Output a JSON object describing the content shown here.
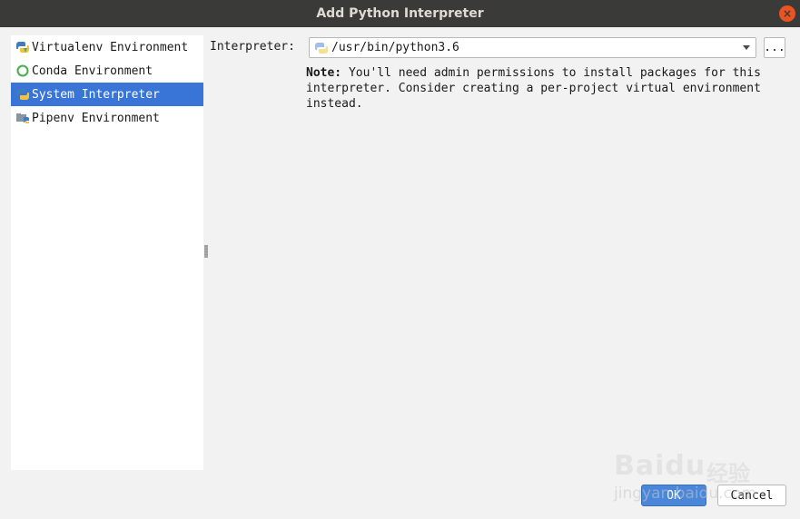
{
  "window": {
    "title": "Add Python Interpreter",
    "close_glyph": "×"
  },
  "sidebar": {
    "items": [
      {
        "label": "Virtualenv Environment",
        "icon": "virtualenv-icon"
      },
      {
        "label": "Conda Environment",
        "icon": "conda-icon"
      },
      {
        "label": "System Interpreter",
        "icon": "python-icon",
        "selected": true
      },
      {
        "label": "Pipenv Environment",
        "icon": "pipenv-icon"
      }
    ]
  },
  "main": {
    "interpreter_label": "Interpreter:",
    "interpreter_value": "/usr/bin/python3.6",
    "browse_label": "...",
    "note_label": "Note:",
    "note_text": " You'll need admin permissions to install packages for this interpreter. Consider creating a per-project virtual environment instead."
  },
  "footer": {
    "ok_label": "OK",
    "cancel_label": "Cancel"
  },
  "watermark": {
    "main": "Baidu",
    "cn": "经验",
    "sub": "jingyan.baidu.com"
  },
  "colors": {
    "selection": "#3875d7",
    "titlebar": "#3a3a38",
    "close": "#e95420",
    "ok_button": "#4a87d8"
  }
}
